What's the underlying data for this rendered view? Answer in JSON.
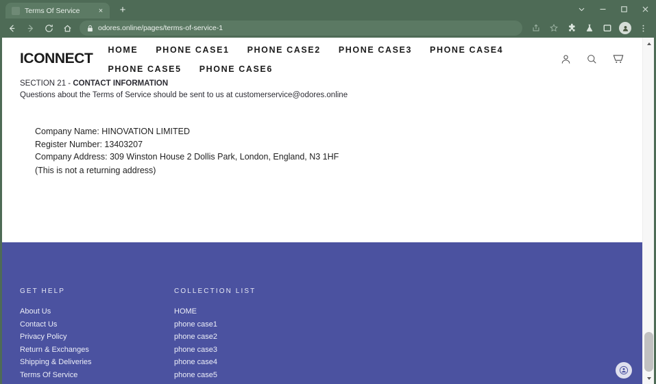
{
  "browser": {
    "tab": {
      "title": "Terms Of Service",
      "close_label": "×"
    },
    "new_tab_label": "+",
    "window_controls": {
      "tab_search": "tab-search",
      "minimize": "minimize",
      "maximize": "maximize",
      "close": "close"
    },
    "nav_buttons": {
      "back": "back",
      "forward": "forward",
      "reload": "reload",
      "home": "home"
    },
    "omnibox": {
      "url": "odores.online/pages/terms-of-service-1",
      "security": "lock-icon"
    },
    "toolbar_icons": [
      "share-icon",
      "bookmark-star-icon",
      "extensions-icon",
      "labs-flask-icon",
      "side-panel-icon",
      "profile-avatar-icon",
      "chrome-menu-icon"
    ]
  },
  "site": {
    "logo": "ICONNECT",
    "nav": [
      {
        "label": "HOME"
      },
      {
        "label": "PHONE CASE1"
      },
      {
        "label": "PHONE CASE2"
      },
      {
        "label": "PHONE CASE3"
      },
      {
        "label": "PHONE CASE4"
      },
      {
        "label": "PHONE CASE5"
      },
      {
        "label": "PHONE CASE6"
      }
    ],
    "header_icons": [
      "account-icon",
      "search-icon",
      "cart-icon"
    ]
  },
  "main": {
    "section_prefix": "SECTION 21 - ",
    "section_title": "CONTACT INFORMATION",
    "paragraph": "Questions about the Terms of Service should be sent to us at customerservice@odores.online",
    "details": [
      "Company Name: HINOVATION LIMITED",
      "Register Number: 13403207",
      "Company Address: 309 Winston House 2 Dollis Park, London, England, N3 1HF",
      "(This is not a returning address)"
    ]
  },
  "footer": {
    "columns": [
      {
        "heading": "GET HELP",
        "links": [
          "About Us",
          "Contact Us",
          "Privacy Policy",
          "Return & Exchanges",
          "Shipping & Deliveries",
          "Terms Of Service"
        ]
      },
      {
        "heading": "COLLECTION LIST",
        "links": [
          "HOME",
          "phone case1",
          "phone case2",
          "phone case3",
          "phone case4",
          "phone case5"
        ]
      }
    ],
    "background_color": "#4b52a0"
  },
  "widgets": {
    "chat_support": "chat-support-icon"
  }
}
